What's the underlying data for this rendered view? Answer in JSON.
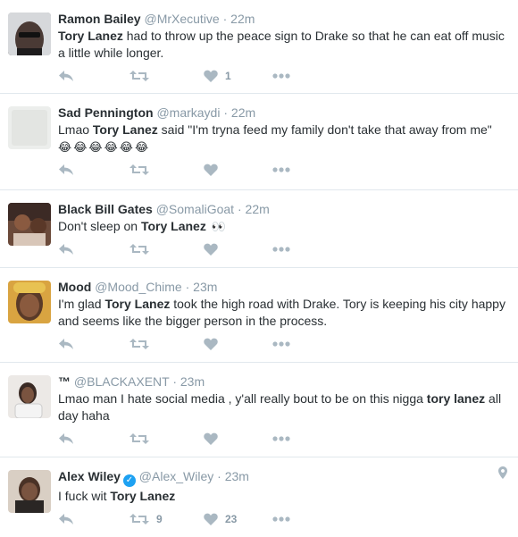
{
  "tweets": [
    {
      "name": "Ramon Bailey",
      "handle": "@MrXecutive",
      "time": "22m",
      "text": [
        {
          "t": "Tory Lanez",
          "b": true
        },
        {
          "t": " had to throw up the peace sign to Drake so that he can eat off music a little while longer.",
          "b": false
        }
      ],
      "retweets": "",
      "likes": "1"
    },
    {
      "name": "Sad Pennington",
      "handle": "@markaydi",
      "time": "22m",
      "text": [
        {
          "t": "Lmao ",
          "b": false
        },
        {
          "t": "Tory Lanez",
          "b": true
        },
        {
          "t": " said \"I'm tryna feed my family don't take that away from me\" ",
          "b": false
        },
        {
          "t": "😂😂😂😂😂😂",
          "b": false,
          "emoji": true
        }
      ],
      "retweets": "",
      "likes": ""
    },
    {
      "name": "Black Bill Gates",
      "handle": "@SomaliGoat",
      "time": "22m",
      "text": [
        {
          "t": "Don't sleep on ",
          "b": false
        },
        {
          "t": "Tory Lanez",
          "b": true
        },
        {
          "t": " 👀",
          "b": false,
          "emoji": true
        }
      ],
      "retweets": "",
      "likes": ""
    },
    {
      "name": "Mood",
      "handle": "@Mood_Chime",
      "time": "23m",
      "text": [
        {
          "t": "I'm glad ",
          "b": false
        },
        {
          "t": "Tory Lanez",
          "b": true
        },
        {
          "t": " took the high road with Drake. Tory is keeping his city happy and seems like the bigger person in the process.",
          "b": false
        }
      ],
      "retweets": "",
      "likes": ""
    },
    {
      "name": "™",
      "handle": "@BLACKAXENT",
      "time": "23m",
      "text": [
        {
          "t": "Lmao man I hate social media , y'all really bout to be on this nigga ",
          "b": false
        },
        {
          "t": "tory lanez",
          "b": true
        },
        {
          "t": " all day haha",
          "b": false
        }
      ],
      "retweets": "",
      "likes": ""
    },
    {
      "name": "Alex Wiley",
      "handle": "@Alex_Wiley",
      "time": "23m",
      "verified": true,
      "geo": true,
      "text": [
        {
          "t": "I fuck wit ",
          "b": false
        },
        {
          "t": "Tory Lanez",
          "b": true
        }
      ],
      "retweets": "9",
      "likes": "23"
    }
  ],
  "ui": {
    "dot": "·",
    "verified_check": "✓"
  },
  "colors": {
    "text": "#292f33",
    "meta": "#8899a6",
    "icon": "#aab8c2",
    "divider": "#e1e8ed",
    "verified": "#1da1f2"
  },
  "icons": {
    "reply": "reply-icon",
    "retweet": "retweet-icon",
    "like": "heart-icon",
    "more": "more-dots-icon",
    "geo": "location-pin-icon",
    "verified": "verified-badge-icon"
  }
}
